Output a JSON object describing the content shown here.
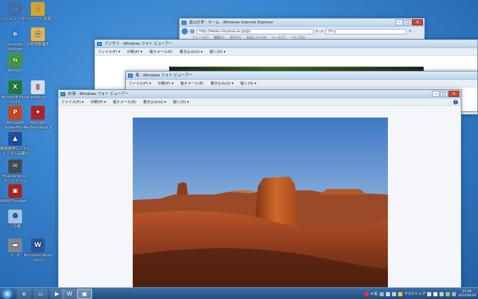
{
  "desktop": {
    "icons": [
      {
        "label": "コンピューター",
        "icon": "computer-icon",
        "color": "#3d6fb0"
      },
      {
        "label": "パスワード変更",
        "icon": "key-icon",
        "color": "#d9a42a"
      },
      {
        "label": "Internet Explorer",
        "icon": "ie-icon",
        "color": "#2a7fd4"
      },
      {
        "label": "印刷残数確認",
        "icon": "printer-folder-icon",
        "color": "#e0b84a"
      },
      {
        "label": "WinSCP",
        "icon": "winscp-icon",
        "color": "#3b9b3b"
      },
      {
        "label": "Microsoft Excel 2010",
        "icon": "excel-icon",
        "color": "#1f7a3a"
      },
      {
        "label": "desktop",
        "icon": "desktop-file-icon",
        "color": "#d8dde6"
      },
      {
        "label": "Microsoft PowerPoint 2010",
        "icon": "powerpoint-icon",
        "color": "#c8461f"
      },
      {
        "label": "Wolfram Mathematica 8",
        "icon": "mathematica-icon",
        "color": "#b0212a"
      },
      {
        "label": "情報倫理デジタルビデオ小品集3",
        "icon": "video-icon",
        "color": "#1d4f9e"
      },
      {
        "label": "Thunderbird... インストーラ",
        "icon": "thunderbird-install-icon",
        "color": "#444a55"
      },
      {
        "label": "ALMDThunder...",
        "icon": "almd-icon",
        "color": "#b02020"
      },
      {
        "label": "ごみ箱",
        "icon": "recycle-bin-icon",
        "color": "#9fc4e8"
      },
      {
        "label": "2：¥",
        "icon": "network-drive-icon",
        "color": "#7d8794"
      },
      {
        "label": "Microsoft Word 2010",
        "icon": "word-icon",
        "color": "#2b579a"
      }
    ]
  },
  "windows": {
    "ie": {
      "title": "富山大学｜ホーム - Windows Internet Explorer",
      "address": "http://www.u-toyama.ac.jp/jp/",
      "search_placeholder": "Bing",
      "menu": [
        "ファイル(F)",
        "編集(E)",
        "表示(V)",
        "お気に入り(A)",
        "ツール(T)",
        "ヘルプ(H)"
      ]
    },
    "viewer_back": {
      "title": "アジサイ - Windows フォト ビューアー",
      "menu": [
        "ファイル(F) ▾",
        "印刷(P) ▾",
        "電子メール(E)",
        "書き込み(U) ▾",
        "開く(O) ▾"
      ]
    },
    "viewer_mid": {
      "title": "菊 - Windows フォト ビューアー",
      "menu": [
        "ファイル(F) ▾",
        "印刷(P) ▾",
        "電子メール(E)",
        "書き込み(U) ▾",
        "開く(O) ▾"
      ]
    },
    "viewer_front": {
      "title": "砂漠 - Windows フォト ビューアー",
      "menu": [
        "ファイル(F) ▾",
        "印刷(P) ▾",
        "電子メール(E)",
        "書き込み(U) ▾",
        "開く(O) ▾"
      ]
    }
  },
  "taskbar": {
    "tray_label": "デスクトップ",
    "ime": "A 般",
    "time": "11:26",
    "date": "2013/04/19"
  }
}
